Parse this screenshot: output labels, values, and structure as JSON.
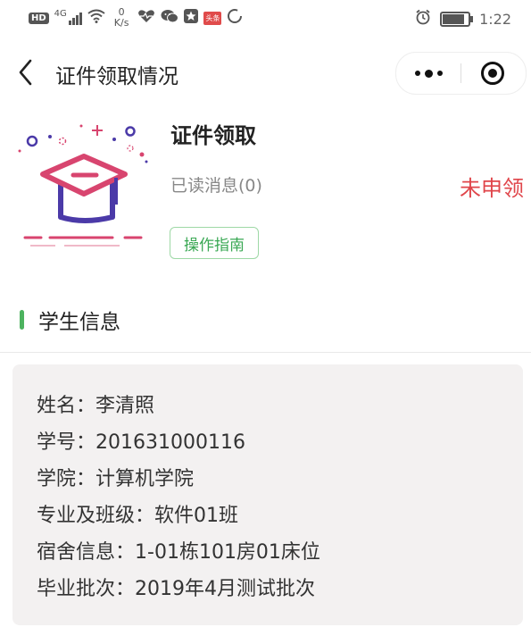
{
  "status_bar": {
    "network_badge": "HD",
    "network_type": "4G",
    "speed_value": "0",
    "speed_unit": "K/s",
    "ad_badge": "头条",
    "time": "1:22",
    "battery_level": 0.85,
    "icons": [
      "signal-icon",
      "wifi-icon",
      "heart-rate-icon",
      "wechat-icon",
      "star-app-icon",
      "toutiao-icon",
      "loading-icon",
      "alarm-icon",
      "battery-icon"
    ]
  },
  "nav": {
    "title": "证件领取情况",
    "back_icon": "back-arrow-icon",
    "more_icon": "more-dots-icon",
    "close_icon": "target-close-icon"
  },
  "card": {
    "title": "证件领取",
    "read_messages": "已读消息(0)",
    "status": "未申领",
    "guide_button": "操作指南",
    "illustration_icon": "graduation-cap-icon"
  },
  "section": {
    "title": "学生信息"
  },
  "student_info": [
    {
      "label": "姓名：",
      "value": "李清照"
    },
    {
      "label": "学号：",
      "value": "201631000116"
    },
    {
      "label": "学院：",
      "value": "计算机学院"
    },
    {
      "label": "专业及班级：",
      "value": "软件01班"
    },
    {
      "label": "宿舍信息：",
      "value": "1-01栋101房01床位"
    },
    {
      "label": "毕业批次：",
      "value": "2019年4月测试批次"
    }
  ],
  "colors": {
    "accent_green": "#4db35f",
    "status_red": "#e0454a",
    "cap_pink": "#d8456f",
    "cap_purple": "#4b3aa8",
    "panel_bg": "#f3f1f1"
  }
}
